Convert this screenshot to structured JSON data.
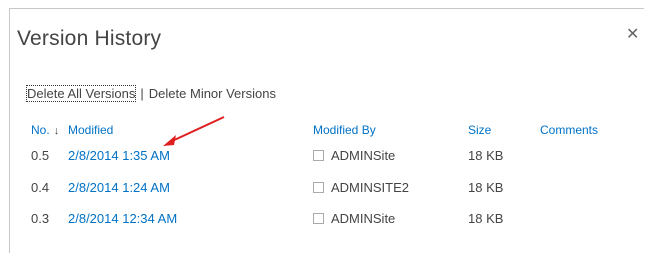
{
  "dialog": {
    "title": "Version History",
    "close_glyph": "✕"
  },
  "actions": {
    "delete_all": "Delete All Versions",
    "separator": "|",
    "delete_minor": "Delete Minor Versions"
  },
  "table": {
    "headers": {
      "no": "No.",
      "sort_glyph": "↓",
      "modified": "Modified",
      "modified_by": "Modified By",
      "size": "Size",
      "comments": "Comments"
    },
    "rows": [
      {
        "no": "0.5",
        "modified": "2/8/2014 1:35 AM",
        "modified_by": "ADMINSite",
        "size": "18 KB"
      },
      {
        "no": "0.4",
        "modified": "2/8/2014 1:24 AM",
        "modified_by": "ADMINSITE2",
        "size": "18 KB"
      },
      {
        "no": "0.3",
        "modified": "2/8/2014 12:34 AM",
        "modified_by": "ADMINSite",
        "size": "18 KB"
      }
    ]
  },
  "annotation": {
    "arrow_color": "#e02020"
  },
  "colors": {
    "link": "#0072c6",
    "text": "#444444",
    "border": "#c8c8c8"
  }
}
